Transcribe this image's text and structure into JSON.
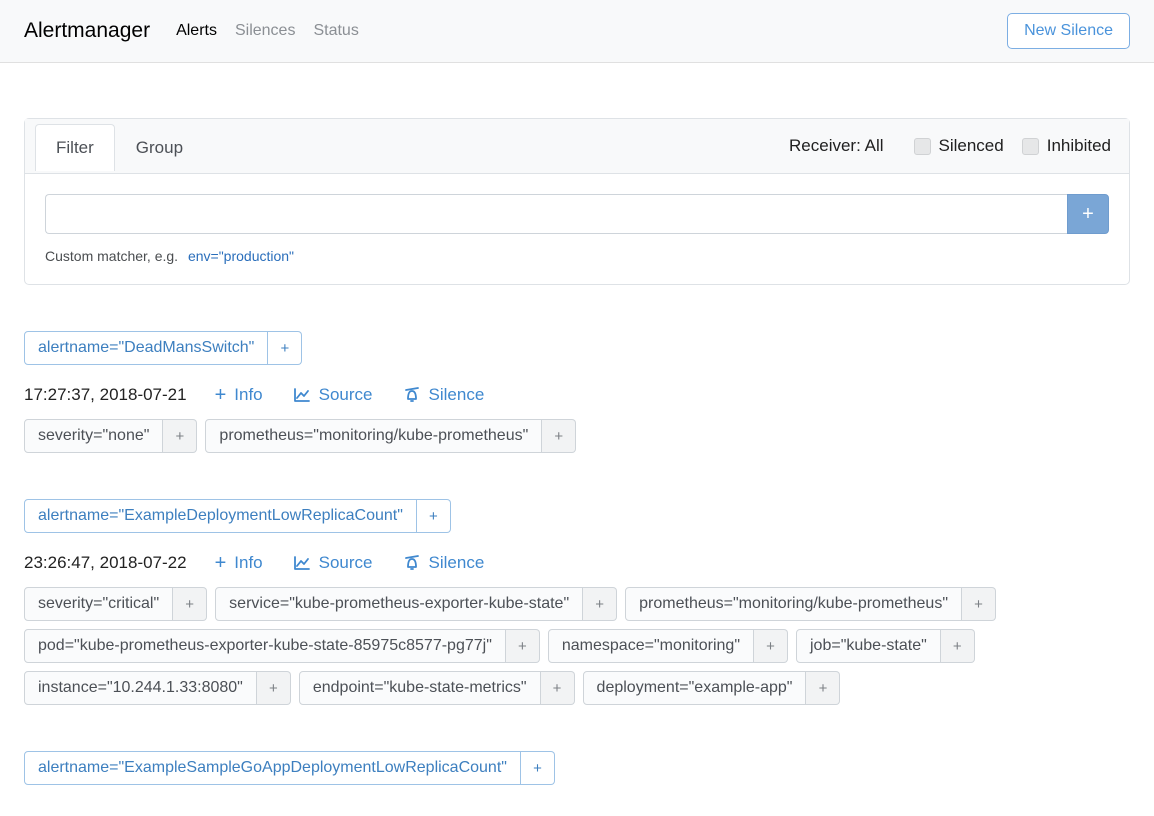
{
  "nav": {
    "brand": "Alertmanager",
    "alerts": "Alerts",
    "silences": "Silences",
    "status": "Status",
    "new_silence": "New Silence"
  },
  "filter": {
    "tab_filter": "Filter",
    "tab_group": "Group",
    "receiver_label": "Receiver: All",
    "chk_silenced": "Silenced",
    "chk_inhibited": "Inhibited",
    "hint_prefix": "Custom matcher, e.g.",
    "hint_example": "env=\"production\""
  },
  "actions": {
    "info": "Info",
    "source": "Source",
    "silence": "Silence"
  },
  "groups": [
    {
      "alertname_tag": "alertname=\"DeadMansSwitch\"",
      "timestamp": "17:27:37, 2018-07-21",
      "labels": [
        "severity=\"none\"",
        "prometheus=\"monitoring/kube-prometheus\""
      ]
    },
    {
      "alertname_tag": "alertname=\"ExampleDeploymentLowReplicaCount\"",
      "timestamp": "23:26:47, 2018-07-22",
      "labels": [
        "severity=\"critical\"",
        "service=\"kube-prometheus-exporter-kube-state\"",
        "prometheus=\"monitoring/kube-prometheus\"",
        "pod=\"kube-prometheus-exporter-kube-state-85975c8577-pg77j\"",
        "namespace=\"monitoring\"",
        "job=\"kube-state\"",
        "instance=\"10.244.1.33:8080\"",
        "endpoint=\"kube-state-metrics\"",
        "deployment=\"example-app\""
      ]
    },
    {
      "alertname_tag": "alertname=\"ExampleSampleGoAppDeploymentLowReplicaCount\""
    }
  ]
}
